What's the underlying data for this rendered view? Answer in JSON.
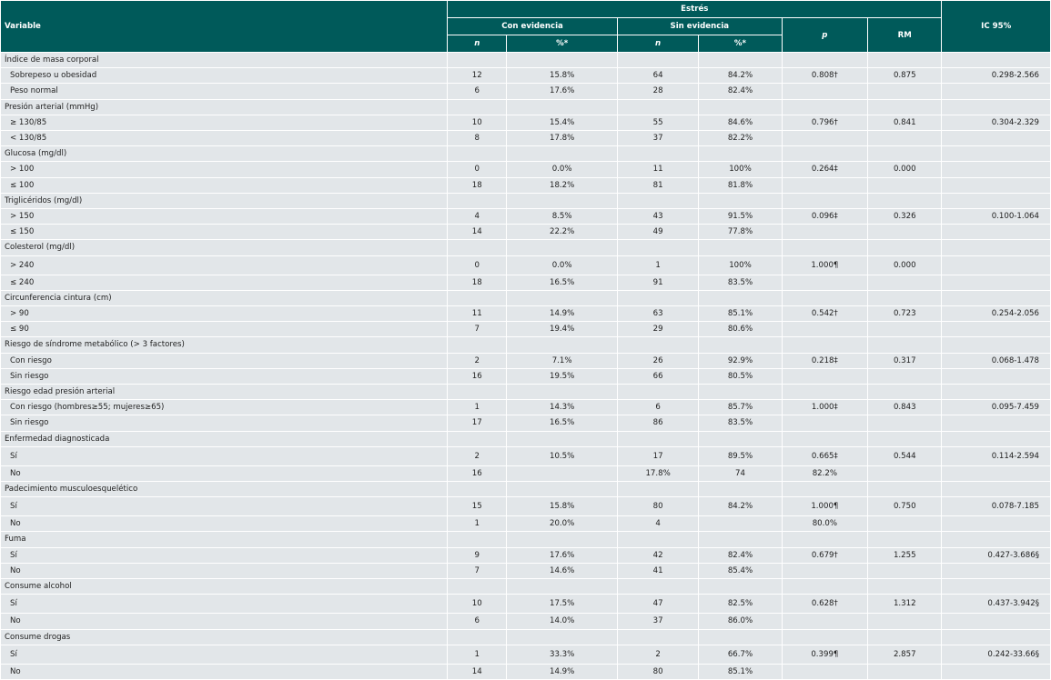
{
  "header": {
    "variable": "Variable",
    "estres": "Estrés",
    "con_evidencia": "Con evidencia",
    "sin_evidencia": "Sin evidencia",
    "n": "n",
    "pct": "%*",
    "p": "p",
    "rm": "RM",
    "ic": "IC 95%"
  },
  "groups": [
    {
      "title": "Índice de masa corporal",
      "rows": [
        {
          "label": "Sobrepeso u obesidad",
          "n1": "12",
          "p1": "15.8%",
          "n2": "64",
          "p2": "84.2%",
          "p": "0.808†",
          "rm": "0.875",
          "ic": "0.298-2.566"
        },
        {
          "label": "Peso normal",
          "n1": "6",
          "p1": "17.6%",
          "n2": "28",
          "p2": "82.4%",
          "p": "",
          "rm": "",
          "ic": ""
        }
      ]
    },
    {
      "title": "Presión arterial (mmHg)",
      "rows": [
        {
          "label": "≥ 130/85",
          "n1": "10",
          "p1": "15.4%",
          "n2": "55",
          "p2": "84.6%",
          "p": "0.796†",
          "rm": "0.841",
          "ic": "0.304-2.329"
        },
        {
          "label": "< 130/85",
          "n1": "8",
          "p1": "17.8%",
          "n2": "37",
          "p2": "82.2%",
          "p": "",
          "rm": "",
          "ic": ""
        }
      ]
    },
    {
      "title": "Glucosa (mg/dl)",
      "rows": [
        {
          "label": "> 100",
          "n1": "0",
          "p1": "0.0%",
          "n2": "11",
          "p2": "100%",
          "p": "0.264‡",
          "rm": "0.000",
          "ic": ""
        },
        {
          "label": "≤ 100",
          "n1": "18",
          "p1": "18.2%",
          "n2": "81",
          "p2": "81.8%",
          "p": "",
          "rm": "",
          "ic": ""
        }
      ]
    },
    {
      "title": "Triglicéridos (mg/dl)",
      "rows": [
        {
          "label": "> 150",
          "n1": "4",
          "p1": "8.5%",
          "n2": "43",
          "p2": "91.5%",
          "p": "0.096‡",
          "rm": "0.326",
          "ic": "0.100-1.064"
        },
        {
          "label": "≤ 150",
          "n1": "14",
          "p1": "22.2%",
          "n2": "49",
          "p2": "77.8%",
          "p": "",
          "rm": "",
          "ic": ""
        }
      ]
    },
    {
      "title": "Colesterol (mg/dl)",
      "tall": true,
      "rows": [
        {
          "label": "> 240",
          "n1": "0",
          "p1": "0.0%",
          "n2": "1",
          "p2": "100%",
          "p": "1.000¶",
          "rm": "0.000",
          "ic": ""
        },
        {
          "label": "≤ 240",
          "n1": "18",
          "p1": "16.5%",
          "n2": "91",
          "p2": "83.5%",
          "p": "",
          "rm": "",
          "ic": ""
        }
      ]
    },
    {
      "title": "Circunferencia cintura (cm)",
      "rows": [
        {
          "label": "> 90",
          "n1": "11",
          "p1": "14.9%",
          "n2": "63",
          "p2": "85.1%",
          "p": "0.542†",
          "rm": "0.723",
          "ic": "0.254-2.056"
        },
        {
          "label": "≤ 90",
          "n1": "7",
          "p1": "19.4%",
          "n2": "29",
          "p2": "80.6%",
          "p": "",
          "rm": "",
          "ic": ""
        }
      ]
    },
    {
      "title": "Riesgo de síndrome metabólico (> 3 factores)",
      "rows": [
        {
          "label": "Con riesgo",
          "n1": "2",
          "p1": "7.1%",
          "n2": "26",
          "p2": "92.9%",
          "p": "0.218‡",
          "rm": "0.317",
          "ic": "0.068-1.478"
        },
        {
          "label": "Sin riesgo",
          "n1": "16",
          "p1": "19.5%",
          "n2": "66",
          "p2": "80.5%",
          "p": "",
          "rm": "",
          "ic": ""
        }
      ]
    },
    {
      "title": "Riesgo edad presión arterial",
      "rows": [
        {
          "label": "Con riesgo (hombres≥55; mujeres≥65)",
          "n1": "1",
          "p1": "14.3%",
          "n2": "6",
          "p2": "85.7%",
          "p": "1.000‡",
          "rm": "0.843",
          "ic": "0.095-7.459"
        },
        {
          "label": "Sin riesgo",
          "n1": "17",
          "p1": "16.5%",
          "n2": "86",
          "p2": "83.5%",
          "p": "",
          "rm": "",
          "ic": ""
        }
      ]
    },
    {
      "title": "Enfermedad diagnosticada",
      "tall": true,
      "rows": [
        {
          "label": "Sí",
          "n1": "2",
          "p1": "10.5%",
          "n2": "17",
          "p2": "89.5%",
          "p": "0.665‡",
          "rm": "0.544",
          "ic": "0.114-2.594"
        },
        {
          "label": "No",
          "n1": "16",
          "p1": "",
          "n2": "17.8%",
          "p2": "74",
          "p": "82.2%",
          "rm": "",
          "ic": ""
        }
      ]
    },
    {
      "title": "Padecimiento musculoesquelético",
      "tall": true,
      "rows": [
        {
          "label": "Sí",
          "n1": "15",
          "p1": "15.8%",
          "n2": "80",
          "p2": "84.2%",
          "p": "1.000¶",
          "rm": "0.750",
          "ic": "0.078-7.185"
        },
        {
          "label": "No",
          "n1": "1",
          "p1": "20.0%",
          "n2": "4",
          "p2": "",
          "p": "80.0%",
          "rm": "",
          "ic": ""
        }
      ]
    },
    {
      "title": "Fuma",
      "rows": [
        {
          "label": "Sí",
          "n1": "9",
          "p1": "17.6%",
          "n2": "42",
          "p2": "82.4%",
          "p": "0.679†",
          "rm": "1.255",
          "ic": "0.427-3.686§"
        },
        {
          "label": "No",
          "n1": "7",
          "p1": "14.6%",
          "n2": "41",
          "p2": "85.4%",
          "p": "",
          "rm": "",
          "ic": ""
        }
      ]
    },
    {
      "title": "Consume alcohol",
      "tall": true,
      "rows": [
        {
          "label": "Sí",
          "n1": "10",
          "p1": "17.5%",
          "n2": "47",
          "p2": "82.5%",
          "p": "0.628†",
          "rm": "1.312",
          "ic": "0.437-3.942§"
        },
        {
          "label": "No",
          "n1": "6",
          "p1": "14.0%",
          "n2": "37",
          "p2": "86.0%",
          "p": "",
          "rm": "",
          "ic": ""
        }
      ]
    },
    {
      "title": "Consume drogas",
      "tall": true,
      "rows": [
        {
          "label": "Sí",
          "n1": "1",
          "p1": "33.3%",
          "n2": "2",
          "p2": "66.7%",
          "p": "0.399¶",
          "rm": "2.857",
          "ic": "0.242-33.66§"
        },
        {
          "label": "No",
          "n1": "14",
          "p1": "14.9%",
          "n2": "80",
          "p2": "85.1%",
          "p": "",
          "rm": "",
          "ic": ""
        }
      ]
    }
  ]
}
